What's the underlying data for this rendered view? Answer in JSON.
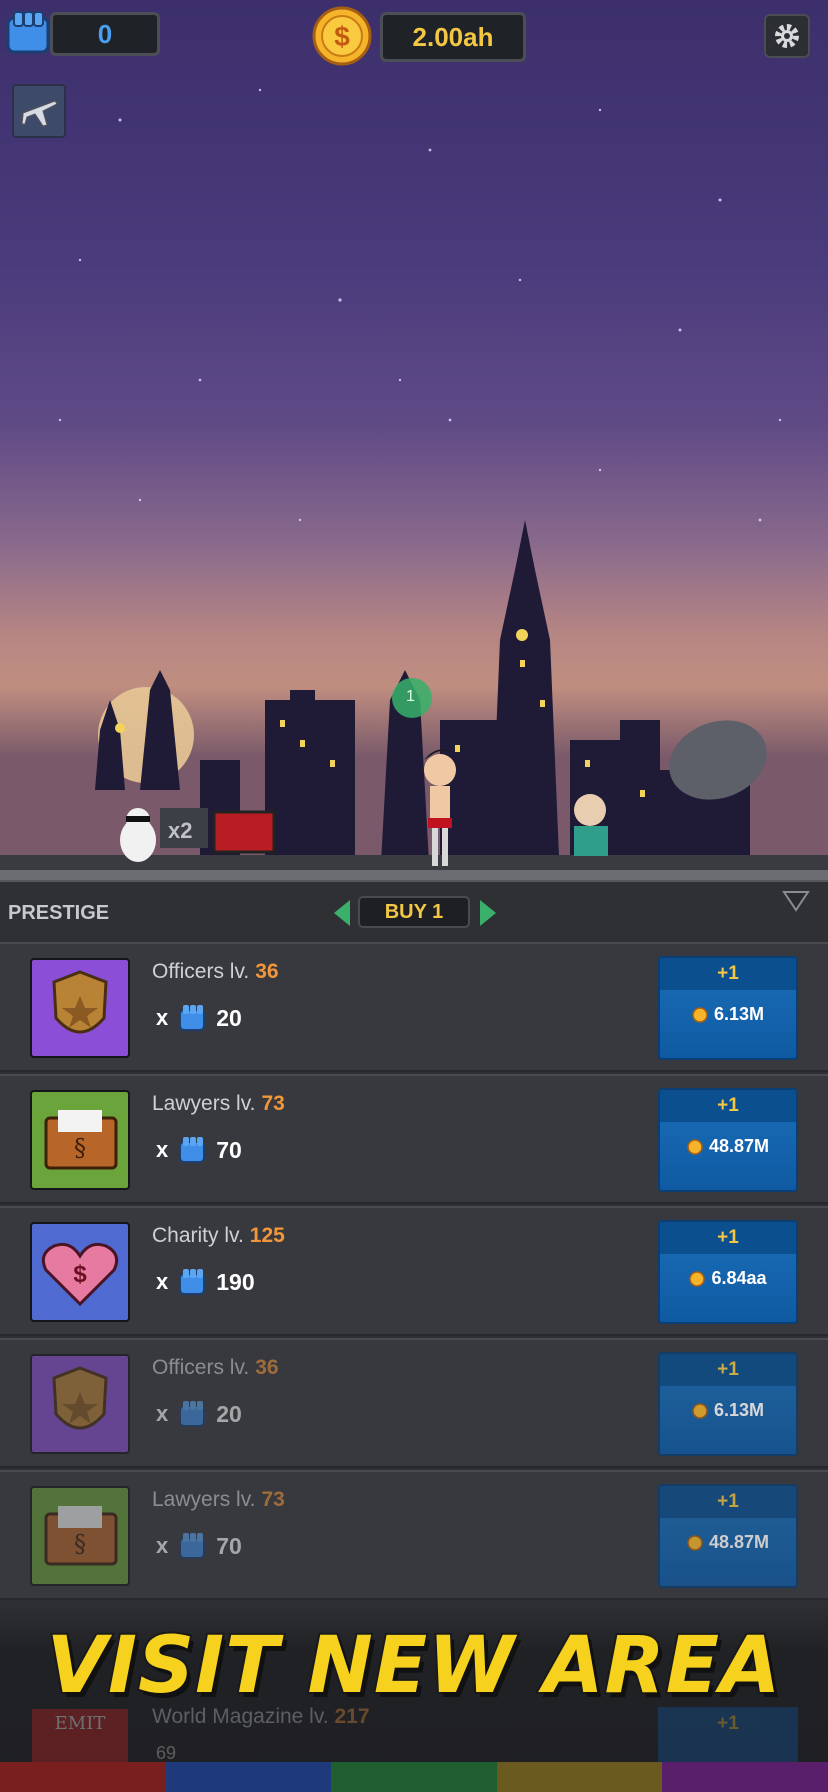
{
  "hud": {
    "fist_count": "0",
    "gold_amount": "2.00ah"
  },
  "scene": {
    "multiplier_badge": "x2",
    "bubble_number": "1"
  },
  "panel": {
    "prestige_label": "PRESTIGE",
    "buy_mode_label": "BUY 1"
  },
  "rows": [
    {
      "name": "Officers lv.",
      "level": "36",
      "x_label": "x",
      "multiplier": "20",
      "upgrade": "+1",
      "cost": "6.13M",
      "icon": "police-badge-icon",
      "thumb_color": "#8a4fd6"
    },
    {
      "name": "Lawyers lv.",
      "level": "73",
      "x_label": "x",
      "multiplier": "70",
      "upgrade": "+1",
      "cost": "48.87M",
      "icon": "folder-icon",
      "thumb_color": "#6aa43a"
    },
    {
      "name": "Charity lv.",
      "level": "125",
      "x_label": "x",
      "multiplier": "190",
      "upgrade": "+1",
      "cost": "6.84aa",
      "icon": "heart-icon",
      "thumb_color": "#4f6ad1"
    },
    {
      "name": "Officers lv.",
      "level": "36",
      "x_label": "x",
      "multiplier": "20",
      "upgrade": "+1",
      "cost": "6.13M",
      "icon": "police-badge-icon",
      "thumb_color": "#8a4fd6"
    },
    {
      "name": "Lawyers lv.",
      "level": "73",
      "x_label": "x",
      "multiplier": "70",
      "upgrade": "+1",
      "cost": "48.87M",
      "icon": "folder-icon",
      "thumb_color": "#6aa43a"
    }
  ],
  "banner": {
    "title": "VISIT NEW AREA",
    "ghost_row_name": "World Magazine lv.",
    "ghost_row_level": "217",
    "ghost_row_multiplier": "69",
    "ghost_row_upgrade": "+1",
    "ghost_thumb_text": "EMIT"
  },
  "colors": {
    "gold": "#f3c744",
    "level_orange": "#f2963a",
    "button_blue": "#1b6fb8",
    "fist_blue": "#4aa0f0"
  }
}
